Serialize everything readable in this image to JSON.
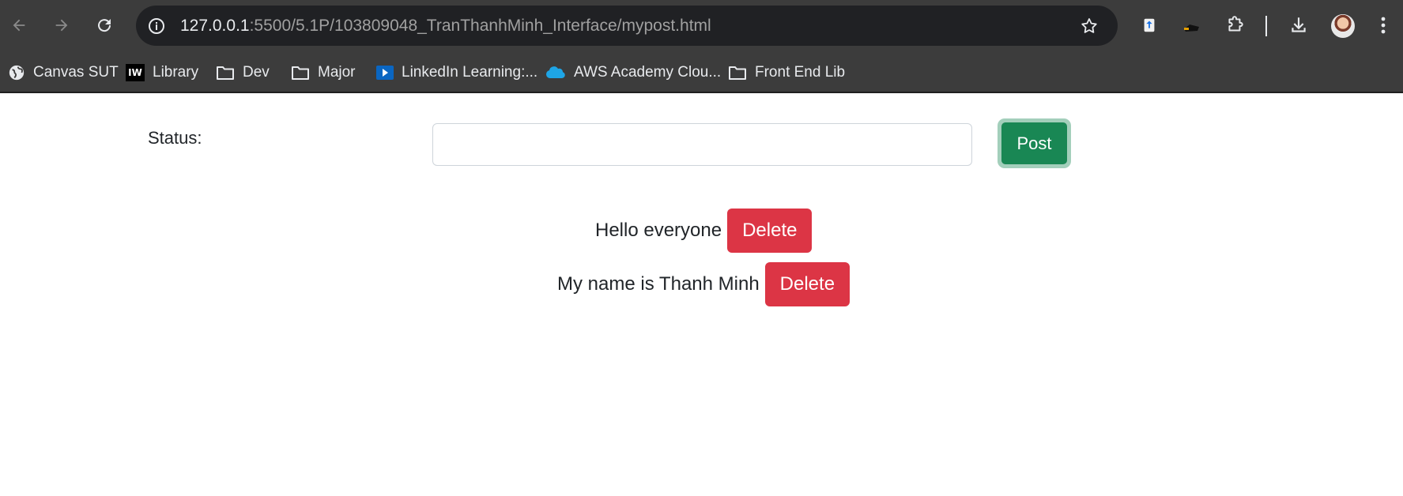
{
  "browser": {
    "url_host": "127.0.0.1",
    "url_rest": ":5500/5.1P/103809048_TranThanhMinh_Interface/mypost.html",
    "icons": [
      "back-arrow-icon",
      "forward-arrow-icon",
      "reload-icon",
      "site-info-icon",
      "bookmark-star-icon",
      "extension-icon",
      "download-icon",
      "kebab-menu-icon"
    ]
  },
  "bookmarks": [
    {
      "label": "Canvas SUT",
      "icon": "globe-icon"
    },
    {
      "label": "Library",
      "icon": "iw-logo-icon",
      "badge": "IW"
    },
    {
      "label": "Dev",
      "icon": "folder-icon"
    },
    {
      "label": "Major",
      "icon": "folder-icon"
    },
    {
      "label": "LinkedIn Learning:...",
      "icon": "linkedin-learning-icon"
    },
    {
      "label": "AWS Academy Clou...",
      "icon": "salesforce-cloud-icon"
    },
    {
      "label": "Front End Lib",
      "icon": "folder-icon"
    }
  ],
  "form": {
    "status_label": "Status:",
    "input_value": "",
    "post_label": "Post"
  },
  "posts": [
    {
      "text": "Hello everyone",
      "delete_label": "Delete"
    },
    {
      "text": "My name is Thanh Minh",
      "delete_label": "Delete"
    }
  ],
  "colors": {
    "post_button": "#198754",
    "post_focus_ring": "#a3cfbb",
    "delete_button": "#dc3545",
    "toolbar": "#3c3c3c",
    "omnibox": "#202124"
  }
}
